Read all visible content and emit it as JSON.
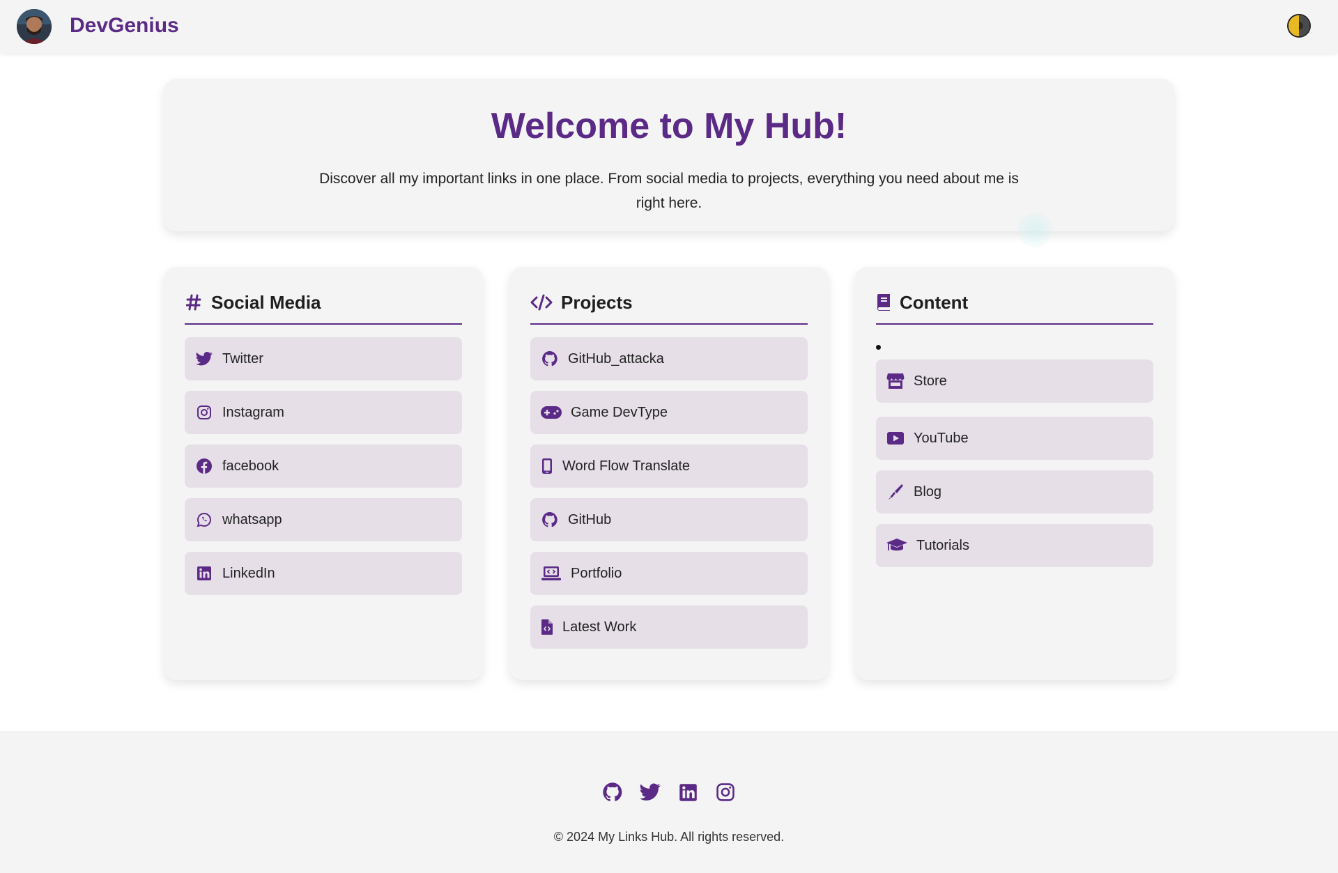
{
  "header": {
    "brand": "DevGenius",
    "avatar_icon": "profile-photo",
    "theme_toggle_icon": "half-moon-toggle-icon"
  },
  "hero": {
    "title": "Welcome to My Hub!",
    "description": "Discover all my important links in one place. From social media to projects, everything you need about me is right here."
  },
  "sections": {
    "social": {
      "title": "Social Media",
      "icon": "hashtag-icon",
      "links": [
        {
          "label": "Twitter",
          "icon": "twitter-icon"
        },
        {
          "label": "Instagram",
          "icon": "instagram-icon"
        },
        {
          "label": "facebook",
          "icon": "facebook-icon"
        },
        {
          "label": "whatsapp",
          "icon": "whatsapp-icon"
        },
        {
          "label": "LinkedIn",
          "icon": "linkedin-icon"
        }
      ]
    },
    "projects": {
      "title": "Projects",
      "icon": "code-icon",
      "links": [
        {
          "label": "GitHub_attacka",
          "icon": "github-icon"
        },
        {
          "label": "Game DevType",
          "icon": "gamepad-icon"
        },
        {
          "label": "Word Flow Translate",
          "icon": "mobile-icon"
        },
        {
          "label": "GitHub",
          "icon": "github-icon"
        },
        {
          "label": "Portfolio",
          "icon": "laptop-code-icon"
        },
        {
          "label": "Latest Work",
          "icon": "file-code-icon"
        }
      ]
    },
    "content": {
      "title": "Content",
      "icon": "book-icon",
      "links": [
        {
          "label": "Store",
          "icon": "store-icon"
        },
        {
          "label": "YouTube",
          "icon": "youtube-icon"
        },
        {
          "label": "Blog",
          "icon": "pen-icon"
        },
        {
          "label": "Tutorials",
          "icon": "graduation-cap-icon"
        }
      ]
    }
  },
  "footer": {
    "icons": [
      "github-icon",
      "twitter-icon",
      "linkedin-icon",
      "instagram-icon"
    ],
    "copyright": "© 2024 My Links Hub. All rights reserved."
  },
  "colors": {
    "accent": "#5b2a86",
    "card_background": "#f4f4f4",
    "link_background": "#e6dfe8",
    "header_background": "#f4f4f4"
  }
}
